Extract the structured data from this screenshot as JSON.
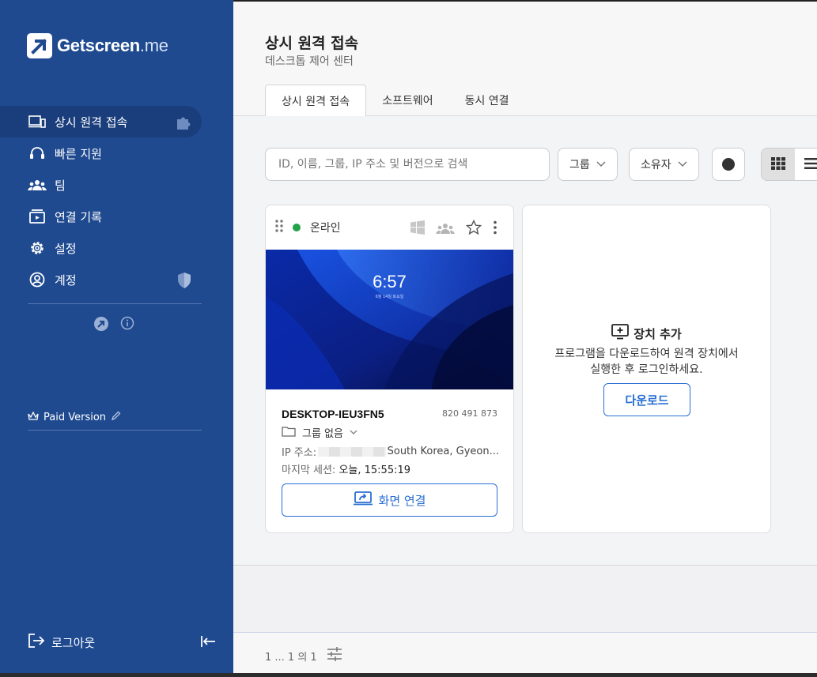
{
  "brand": {
    "name": "Getscreen",
    "suffix": ".me"
  },
  "sidebar": {
    "items": [
      {
        "label": "상시 원격 접속",
        "icon": "devices-icon",
        "extra": "puzzle-icon",
        "active": true
      },
      {
        "label": "빠른 지원",
        "icon": "headset-icon"
      },
      {
        "label": "팀",
        "icon": "team-icon"
      },
      {
        "label": "연결 기록",
        "icon": "history-icon"
      },
      {
        "label": "설정",
        "icon": "gear-icon"
      },
      {
        "label": "계정",
        "icon": "account-icon",
        "extra": "shield-icon"
      }
    ],
    "paid_version": "Paid Version",
    "logout": "로그아웃"
  },
  "header": {
    "title": "상시 원격 접속",
    "subtitle": "데스크톱 제어 센터",
    "tabs": [
      {
        "label": "상시 원격 접속",
        "active": true
      },
      {
        "label": "소프트웨어"
      },
      {
        "label": "동시 연결"
      }
    ]
  },
  "toolbar": {
    "search_placeholder": "ID, 이름, 그룹, IP 주소 및 버전으로 검색",
    "group_label": "그룹",
    "owner_label": "소유자"
  },
  "device": {
    "status": "온라인",
    "thumb_time": "6:57",
    "thumb_date": "6월 14일 토요일",
    "name": "DESKTOP-IEU3FN5",
    "id": "820 491 873",
    "group": "그룹 없음",
    "ip_label": "IP 주소:",
    "location": "South Korea, Gyeon...",
    "session_label": "마지막 세션:",
    "session_value": "오늘, 15:55:19",
    "connect_label": "화면 연결"
  },
  "add_device": {
    "title": "장치 추가",
    "desc_line1": "프로그램을 다운로드하여 원격 장치에서",
    "desc_line2": "실행한 후 로그인하세요.",
    "download_label": "다운로드"
  },
  "pager": {
    "text": "1 ... 1 의 1"
  },
  "colors": {
    "sidebar": "#1f4a90",
    "accent": "#2a6fd3",
    "online": "#21a24b"
  }
}
